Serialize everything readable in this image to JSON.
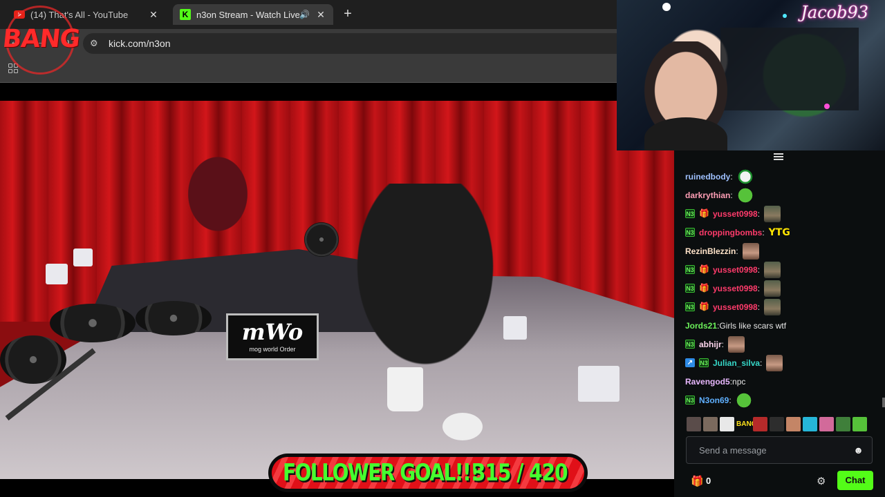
{
  "browser": {
    "tabs": [
      {
        "title": "(14) That's All - YouTube",
        "icon": "youtube-icon",
        "active": false
      },
      {
        "title": "n3on Stream - Watch Live o",
        "icon": "kick-icon",
        "active": true
      }
    ],
    "new_tab_symbol": "+",
    "close_symbol": "✕",
    "url": "kick.com/n3on"
  },
  "overlay": {
    "logo_text": "BANG",
    "webcam_name": "Jacob93",
    "sign_main": "mWo",
    "sign_sub": "mog world Order",
    "follower_goal": {
      "label": "FOLLOWER GOAL!!!",
      "count": "315 / 420",
      "current": 315,
      "target": 420
    },
    "colors": {
      "goal_text": "#46ff2f",
      "goal_bg": "#e01018"
    }
  },
  "chat": {
    "messages": [
      {
        "badges": [],
        "user": "ruinedbody",
        "color": "#9fc1ff",
        "text": "",
        "emote": "mask"
      },
      {
        "badges": [],
        "user": "darkrythian",
        "color": "#ff9fb6",
        "text": "",
        "emote": "frog"
      },
      {
        "badges": [
          "n3",
          "gift"
        ],
        "user": "yusset0998",
        "color": "#ff3b6b",
        "text": "",
        "emote": "army"
      },
      {
        "badges": [
          "n3"
        ],
        "user": "droppingbombs",
        "color": "#ff3b6b",
        "text": "",
        "emote": "ytg"
      },
      {
        "badges": [],
        "user": "RezinBlezzin",
        "color": "#ffe3c9",
        "text": "",
        "emote": "face"
      },
      {
        "badges": [
          "n3",
          "gift"
        ],
        "user": "yusset0998",
        "color": "#ff3b6b",
        "text": "",
        "emote": "army"
      },
      {
        "badges": [
          "n3",
          "gift"
        ],
        "user": "yusset0998",
        "color": "#ff3b6b",
        "text": "",
        "emote": "army"
      },
      {
        "badges": [
          "n3",
          "gift"
        ],
        "user": "yusset0998",
        "color": "#ff3b6b",
        "text": "",
        "emote": "army"
      },
      {
        "badges": [],
        "user": "Jords21",
        "color": "#6cf05a",
        "text": "Girls like scars wtf",
        "emote": ""
      },
      {
        "badges": [
          "n3"
        ],
        "user": "abhijr",
        "color": "#ffd7ee",
        "text": "",
        "emote": "face"
      },
      {
        "badges": [
          "boost",
          "n3"
        ],
        "user": "Julian_silva",
        "color": "#36d7c8",
        "text": "",
        "emote": "face"
      },
      {
        "badges": [],
        "user": "Ravengod5",
        "color": "#e9b8ff",
        "text": "npc",
        "emote": ""
      },
      {
        "badges": [
          "n3"
        ],
        "user": "N3on69",
        "color": "#5fb0ff",
        "text": "",
        "emote": "frog"
      }
    ],
    "badge_labels": {
      "n3": "N3",
      "gift": "🎁",
      "boost": "↗"
    },
    "ytg_text": "YTG",
    "emote_bar_colors": [
      "#5a4c4a",
      "#7b6a5e",
      "#e8e8e8",
      "#ffe21b",
      "#b52a2a",
      "#2d2d2d",
      "#c48566",
      "#26b6d8",
      "#d26a9a",
      "#3f7f3a",
      "#56c23a"
    ],
    "emote_bar_bang": "BANG",
    "input_placeholder": "Send a message",
    "gift_count": "0",
    "chat_button": "Chat"
  }
}
